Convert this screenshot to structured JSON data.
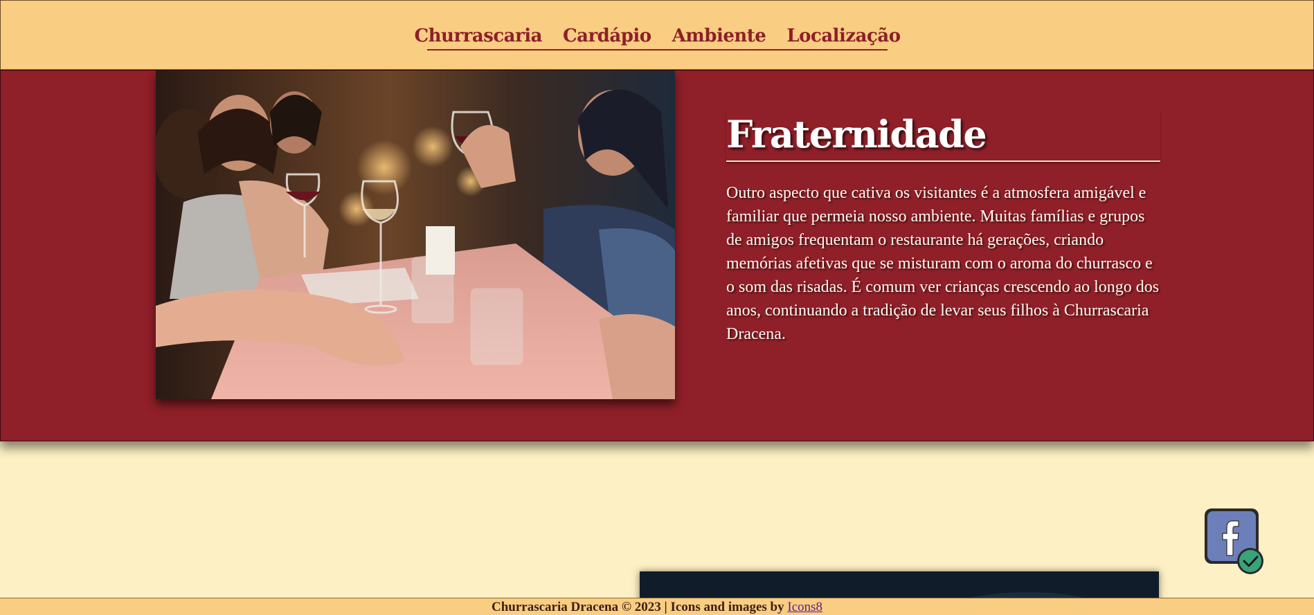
{
  "nav": {
    "items": [
      {
        "label": "Churrascaria"
      },
      {
        "label": "Cardápio"
      },
      {
        "label": "Ambiente"
      },
      {
        "label": "Localização"
      }
    ]
  },
  "hero": {
    "title": "Fraternidade",
    "body": "Outro aspecto que cativa os visitantes é a atmosfera amigável e familiar que permeia nosso ambiente. Muitas famílias e grupos de amigos frequentam o restaurante há gerações, criando memórias afetivas que se misturam com o aroma do churrasco e o som das risadas. É comum ver crianças crescendo ao longo dos anos, continuando a tradição de levar seus filhos à Churrascaria Dracena."
  },
  "footer": {
    "text": "Churrascaria Dracena © 2023 | Icons and images by ",
    "link_label": "Icons8"
  },
  "colors": {
    "header_bg": "#f9cd82",
    "accent": "#8f1f28",
    "page_bg": "#fdf0c4",
    "facebook": "#6d7fb8",
    "check": "#3aa37a"
  },
  "icons": {
    "social": "facebook-icon",
    "verified": "check-icon"
  }
}
